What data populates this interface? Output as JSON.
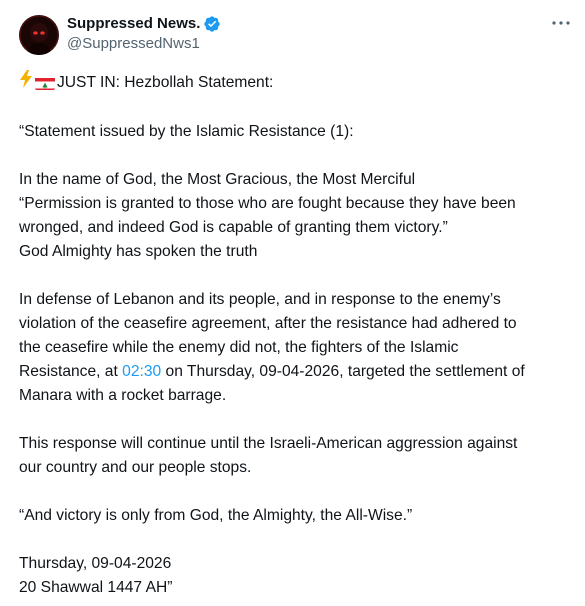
{
  "author": {
    "display_name": "Suppressed News.",
    "handle": "@SuppressedNws1",
    "verified": true,
    "badge_color": "#1d9bf0"
  },
  "post": {
    "headline": "JUST IN: Hezbollah Statement:",
    "p1": "“Statement issued by the Islamic Resistance (1):",
    "p2_l1": "In the name of God, the Most Gracious, the Most Merciful",
    "p2_l2": "“Permission is granted to those who are fought because they have been",
    "p2_l3": "wronged, and indeed God is capable of granting them victory.”",
    "p2_l4": "God Almighty has spoken the truth",
    "p3_l1": "In defense of Lebanon and its people, and in response to the enemy’s",
    "p3_l2": "violation of the ceasefire agreement, after the resistance had adhered to",
    "p3_l3": "the ceasefire while the enemy did not, the fighters of the Islamic",
    "p3_l4_pre": "Resistance, at ",
    "p3_l4_time": "02:30",
    "p3_l4_post": " on Thursday, 09-04-2026, targeted the settlement of",
    "p3_l5": "Manara with a rocket barrage.",
    "p4_l1": "This response will continue until the Israeli-American aggression against",
    "p4_l2": "our country and our people stops.",
    "p5": "“And victory is only from God, the Almighty, the All-Wise.”",
    "p6_l1": "Thursday, 09-04-2026",
    "p6_l2": "20 Shawwal 1447 AH”"
  },
  "icons": {
    "headline_emoji_1": "lightning-icon",
    "headline_emoji_2": "lebanon-flag-icon",
    "more": "more-options-icon",
    "verified": "verified-badge-icon"
  },
  "colors": {
    "text": "#0f1419",
    "secondary_text": "#536471",
    "link": "#1d9bf0"
  }
}
